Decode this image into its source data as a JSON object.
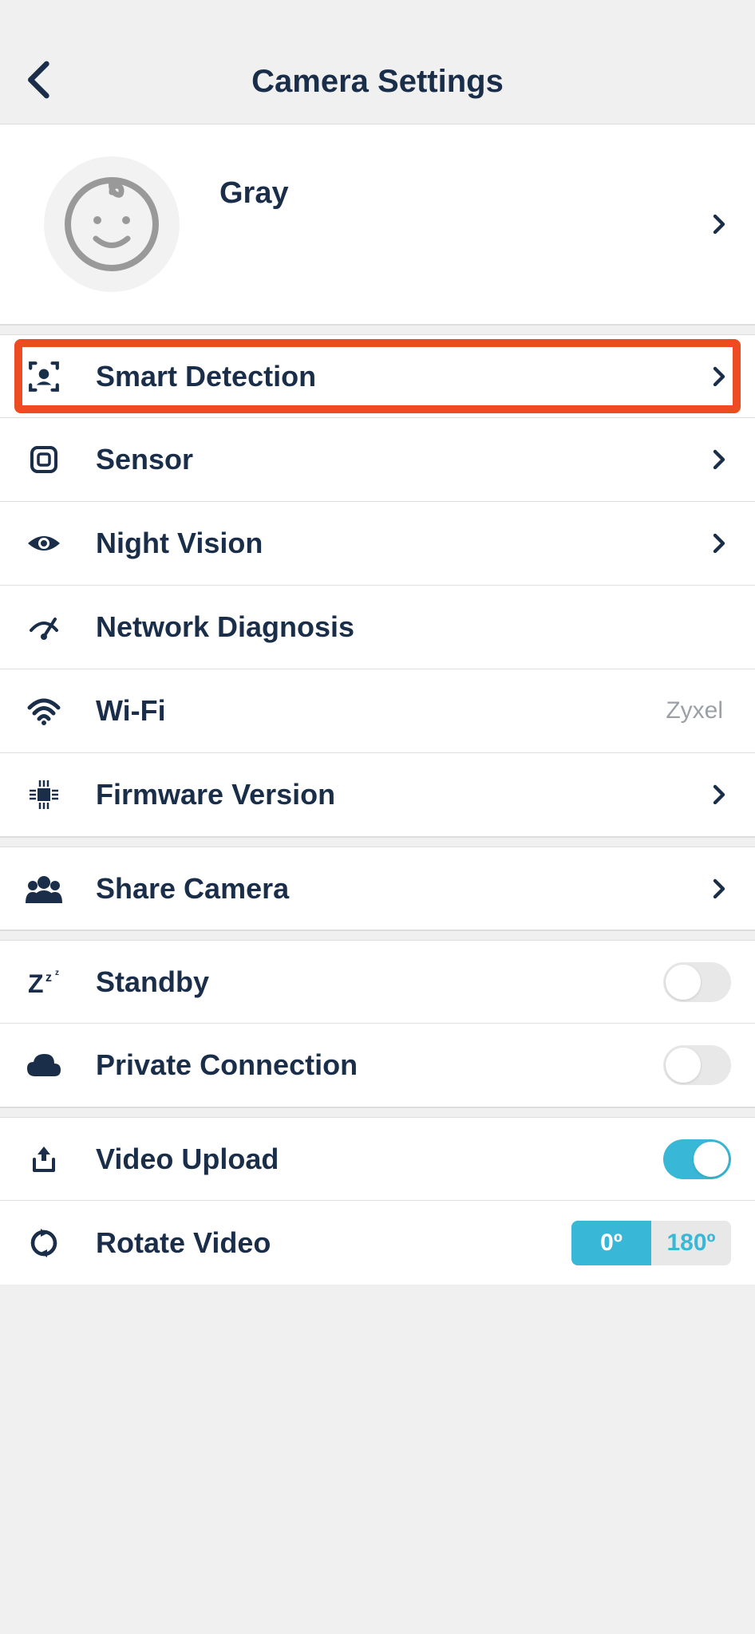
{
  "header": {
    "title": "Camera Settings"
  },
  "profile": {
    "name": "Gray"
  },
  "settings": {
    "smart_detection": {
      "label": "Smart Detection"
    },
    "sensor": {
      "label": "Sensor"
    },
    "night_vision": {
      "label": "Night Vision"
    },
    "network_diagnosis": {
      "label": "Network Diagnosis"
    },
    "wifi": {
      "label": "Wi-Fi",
      "value": "Zyxel"
    },
    "firmware": {
      "label": "Firmware Version"
    },
    "share_camera": {
      "label": "Share Camera"
    },
    "standby": {
      "label": "Standby",
      "enabled": false
    },
    "private_connection": {
      "label": "Private Connection",
      "enabled": false
    },
    "video_upload": {
      "label": "Video Upload",
      "enabled": true
    },
    "rotate_video": {
      "label": "Rotate Video",
      "options": [
        "0º",
        "180º"
      ],
      "selected": "0º"
    }
  }
}
